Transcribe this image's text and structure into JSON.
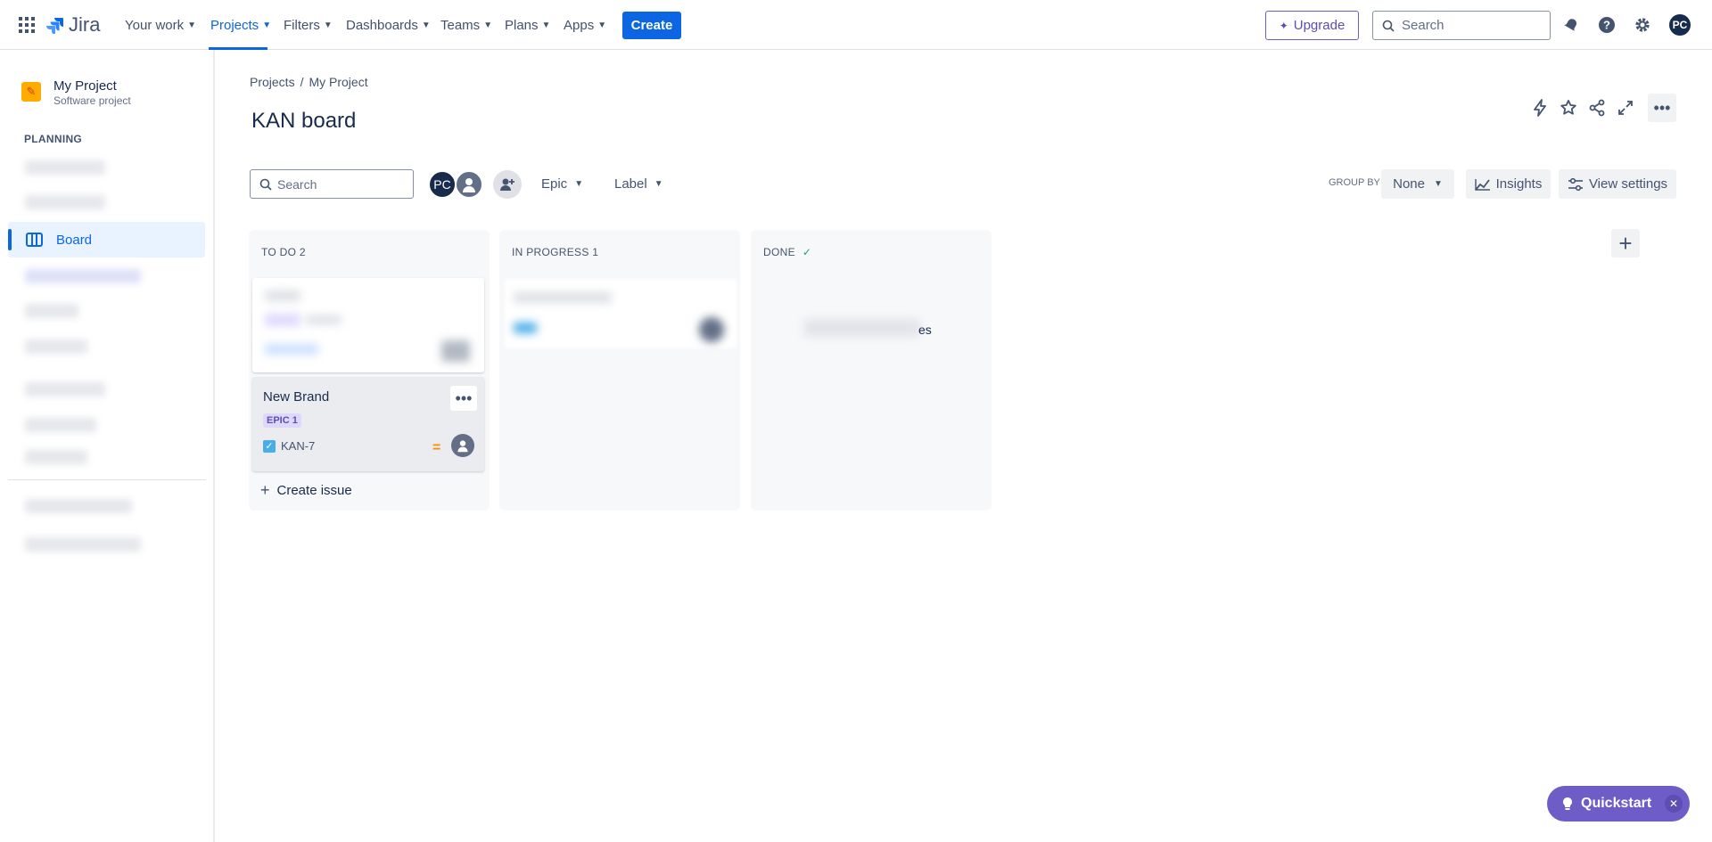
{
  "topbar": {
    "logo_text": "Jira",
    "nav": [
      {
        "label": "Your work"
      },
      {
        "label": "Projects"
      },
      {
        "label": "Filters"
      },
      {
        "label": "Dashboards"
      },
      {
        "label": "Teams"
      },
      {
        "label": "Plans"
      },
      {
        "label": "Apps"
      }
    ],
    "create_label": "Create",
    "upgrade_label": "Upgrade",
    "search_placeholder": "Search",
    "user_initials": "PC"
  },
  "sidebar": {
    "project_name": "My Project",
    "project_type": "Software project",
    "planning_heading": "PLANNING",
    "board_label": "Board"
  },
  "main": {
    "breadcrumb": [
      "Projects",
      "My Project"
    ],
    "title": "KAN board",
    "search_placeholder": "Search",
    "avatar_initials": "PC",
    "filters": {
      "epic": "Epic",
      "label": "Label"
    },
    "group_by_label": "GROUP BY",
    "group_by_value": "None",
    "insights_label": "Insights",
    "view_settings_label": "View settings",
    "columns": [
      {
        "title": "TO DO 2"
      },
      {
        "title": "IN PROGRESS 1"
      },
      {
        "title": "DONE"
      }
    ],
    "card": {
      "title": "New Brand",
      "epic": "EPIC 1",
      "key": "KAN-7"
    },
    "create_issue_label": "Create issue",
    "done_partial_text": "es"
  },
  "quickstart_label": "Quickstart",
  "colors": {
    "accent": "#0c66e4",
    "quickstart": "#6e5dc6",
    "epic_bg": "#dfd8fd"
  }
}
